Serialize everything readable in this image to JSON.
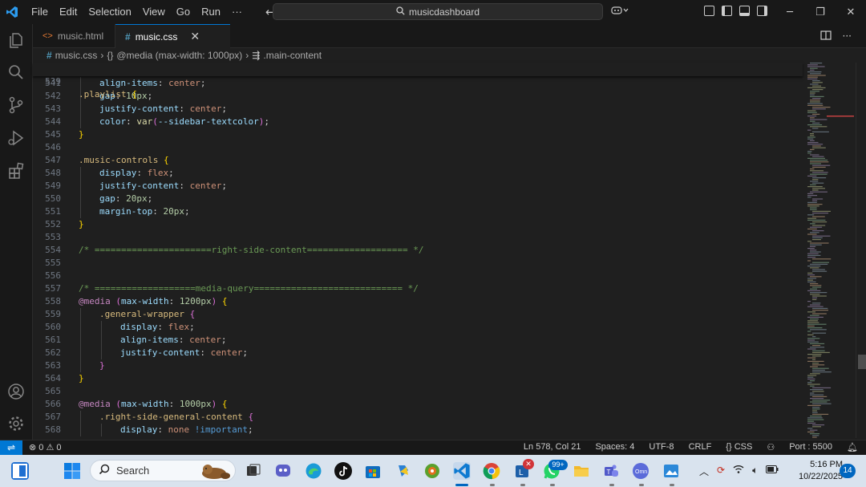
{
  "menu": [
    "File",
    "Edit",
    "Selection",
    "View",
    "Go",
    "Run",
    "···"
  ],
  "search": {
    "text": "musicdashboard"
  },
  "tabs": [
    {
      "label": "music.html",
      "icon": "html-file-icon",
      "active": false
    },
    {
      "label": "music.css",
      "icon": "css-file-icon",
      "active": true
    }
  ],
  "breadcrumb": {
    "file": "music.css",
    "media": "@media (max-width: 1000px)",
    "selector": ".main-content"
  },
  "sticky_line": {
    "number": "539",
    "text": ".playlist {"
  },
  "editor_lines": [
    {
      "n": "541",
      "indent": 1,
      "tokens": [
        [
          "prop",
          "align-items"
        ],
        [
          "punc",
          ": "
        ],
        [
          "val",
          "center"
        ],
        [
          "punc",
          ";"
        ]
      ]
    },
    {
      "n": "542",
      "indent": 1,
      "tokens": [
        [
          "prop",
          "gap"
        ],
        [
          "punc",
          ": "
        ],
        [
          "num",
          "10px"
        ],
        [
          "punc",
          ";"
        ]
      ]
    },
    {
      "n": "543",
      "indent": 1,
      "tokens": [
        [
          "prop",
          "justify-content"
        ],
        [
          "punc",
          ": "
        ],
        [
          "val",
          "center"
        ],
        [
          "punc",
          ";"
        ]
      ]
    },
    {
      "n": "544",
      "indent": 1,
      "tokens": [
        [
          "prop",
          "color"
        ],
        [
          "punc",
          ": "
        ],
        [
          "var",
          "var"
        ],
        [
          "brace2",
          "("
        ],
        [
          "prop",
          "--sidebar-textcolor"
        ],
        [
          "brace2",
          ")"
        ],
        [
          "punc",
          ";"
        ]
      ]
    },
    {
      "n": "545",
      "indent": 0,
      "tokens": [
        [
          "brace",
          "}"
        ]
      ]
    },
    {
      "n": "546",
      "indent": 0,
      "tokens": []
    },
    {
      "n": "547",
      "indent": 0,
      "tokens": [
        [
          "sel",
          ".music-controls"
        ],
        [
          "punc",
          " "
        ],
        [
          "brace",
          "{"
        ]
      ]
    },
    {
      "n": "548",
      "indent": 1,
      "tokens": [
        [
          "prop",
          "display"
        ],
        [
          "punc",
          ": "
        ],
        [
          "val",
          "flex"
        ],
        [
          "punc",
          ";"
        ]
      ]
    },
    {
      "n": "549",
      "indent": 1,
      "tokens": [
        [
          "prop",
          "justify-content"
        ],
        [
          "punc",
          ": "
        ],
        [
          "val",
          "center"
        ],
        [
          "punc",
          ";"
        ]
      ]
    },
    {
      "n": "550",
      "indent": 1,
      "tokens": [
        [
          "prop",
          "gap"
        ],
        [
          "punc",
          ": "
        ],
        [
          "num",
          "20px"
        ],
        [
          "punc",
          ";"
        ]
      ]
    },
    {
      "n": "551",
      "indent": 1,
      "tokens": [
        [
          "prop",
          "margin-top"
        ],
        [
          "punc",
          ": "
        ],
        [
          "num",
          "20px"
        ],
        [
          "punc",
          ";"
        ]
      ]
    },
    {
      "n": "552",
      "indent": 0,
      "tokens": [
        [
          "brace",
          "}"
        ]
      ]
    },
    {
      "n": "553",
      "indent": 0,
      "tokens": []
    },
    {
      "n": "554",
      "indent": 0,
      "tokens": [
        [
          "com",
          "/* ======================right-side-content=================== */"
        ]
      ]
    },
    {
      "n": "555",
      "indent": 0,
      "tokens": []
    },
    {
      "n": "556",
      "indent": 0,
      "tokens": []
    },
    {
      "n": "557",
      "indent": 0,
      "tokens": [
        [
          "com",
          "/* ===================media-query============================ */"
        ]
      ]
    },
    {
      "n": "558",
      "indent": 0,
      "tokens": [
        [
          "at",
          "@media"
        ],
        [
          "punc",
          " "
        ],
        [
          "brace2",
          "("
        ],
        [
          "prop",
          "max-width"
        ],
        [
          "punc",
          ": "
        ],
        [
          "num",
          "1200px"
        ],
        [
          "brace2",
          ")"
        ],
        [
          "punc",
          " "
        ],
        [
          "brace",
          "{"
        ]
      ]
    },
    {
      "n": "559",
      "indent": 1,
      "tokens": [
        [
          "sel",
          ".general-wrapper"
        ],
        [
          "punc",
          " "
        ],
        [
          "brace2",
          "{"
        ]
      ]
    },
    {
      "n": "560",
      "indent": 2,
      "tokens": [
        [
          "prop",
          "display"
        ],
        [
          "punc",
          ": "
        ],
        [
          "val",
          "flex"
        ],
        [
          "punc",
          ";"
        ]
      ]
    },
    {
      "n": "561",
      "indent": 2,
      "tokens": [
        [
          "prop",
          "align-items"
        ],
        [
          "punc",
          ": "
        ],
        [
          "val",
          "center"
        ],
        [
          "punc",
          ";"
        ]
      ]
    },
    {
      "n": "562",
      "indent": 2,
      "tokens": [
        [
          "prop",
          "justify-content"
        ],
        [
          "punc",
          ": "
        ],
        [
          "val",
          "center"
        ],
        [
          "punc",
          ";"
        ]
      ]
    },
    {
      "n": "563",
      "indent": 1,
      "tokens": [
        [
          "brace2",
          "}"
        ]
      ]
    },
    {
      "n": "564",
      "indent": 0,
      "tokens": [
        [
          "brace",
          "}"
        ]
      ]
    },
    {
      "n": "565",
      "indent": 0,
      "tokens": []
    },
    {
      "n": "566",
      "indent": 0,
      "tokens": [
        [
          "at",
          "@media"
        ],
        [
          "punc",
          " "
        ],
        [
          "brace2",
          "("
        ],
        [
          "prop",
          "max-width"
        ],
        [
          "punc",
          ": "
        ],
        [
          "num",
          "1000px"
        ],
        [
          "brace2",
          ")"
        ],
        [
          "punc",
          " "
        ],
        [
          "brace",
          "{"
        ]
      ]
    },
    {
      "n": "567",
      "indent": 1,
      "tokens": [
        [
          "sel",
          ".right-side-general-content"
        ],
        [
          "punc",
          " "
        ],
        [
          "brace2",
          "{"
        ]
      ]
    },
    {
      "n": "568",
      "indent": 2,
      "tokens": [
        [
          "prop",
          "display"
        ],
        [
          "punc",
          ": "
        ],
        [
          "val",
          "none"
        ],
        [
          "punc",
          " "
        ],
        [
          "imp",
          "!important"
        ],
        [
          "punc",
          ";"
        ]
      ]
    }
  ],
  "statusbar": {
    "problems": "⊗ 0 ⚠ 0",
    "position": "Ln 578, Col 21",
    "spaces": "Spaces: 4",
    "encoding": "UTF-8",
    "eol": "CRLF",
    "language": "{} CSS",
    "port": "Port : 5500"
  },
  "taskbar": {
    "search_placeholder": "Search",
    "badge_99": "99+",
    "badge_x": "✕",
    "time": "5:16 PM",
    "date": "10/22/2025",
    "notifications": "14"
  },
  "colors": {
    "accent": "#0078d4",
    "editor_bg": "#1f1f1f",
    "taskbar_bg": "#d9e3ee"
  }
}
